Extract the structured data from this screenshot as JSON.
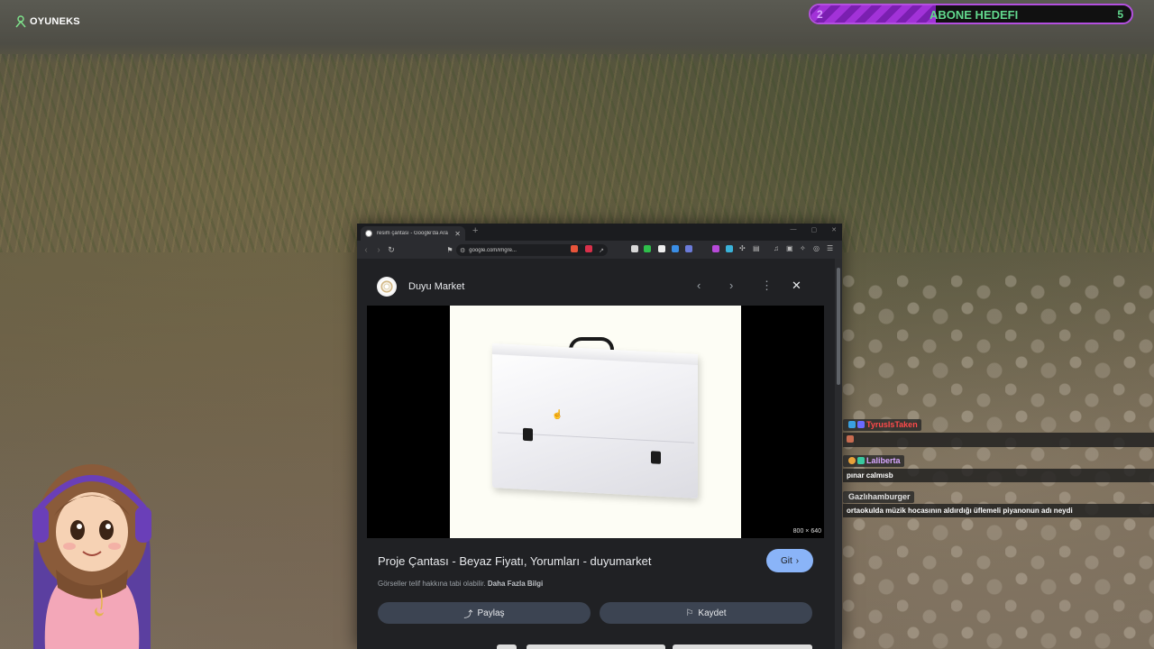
{
  "stream_overlay": {
    "logo_text": "OYUNEKS",
    "goal": {
      "start": "2",
      "label": "ABONE HEDEFI",
      "end": "5",
      "progress": 0.39,
      "fill_color": "#a232d8",
      "text_color": "#62d98e"
    }
  },
  "browser": {
    "tab_title": "resim çantası - Google'da Ara",
    "new_tab_symbol": "+",
    "url": "google.com/imgre...",
    "icons": {
      "back": "back-arrow-icon",
      "forward": "forward-arrow-icon",
      "reload": "reload-icon",
      "bookmark": "bookmark-icon"
    }
  },
  "image_viewer": {
    "source_name": "Duyu Market",
    "image_dimensions": "800 × 640",
    "title": "Proje Çantası - Beyaz Fiyatı, Yorumları - duyumarket",
    "visit_label": "Git",
    "copyright_text": "Görseller telif hakkına tabi olabilir.",
    "learn_more_label": "Daha Fazla Bilgi",
    "share_label": "Paylaş",
    "save_label": "Kaydet",
    "accent_color": "#8ab4f8"
  },
  "chat": {
    "messages": [
      {
        "user": "TyrusIsTaken",
        "user_color": "#ff4a4a",
        "text": ""
      },
      {
        "user": "Laliberta",
        "user_color": "#d7a6ff",
        "text": "pınar calmısb"
      },
      {
        "user": "Gazlıhamburger",
        "user_color": "#e0e0e0",
        "text": "ortaokulda müzik hocasının aldırdığı üflemeli piyanonun adı neydi"
      }
    ]
  }
}
